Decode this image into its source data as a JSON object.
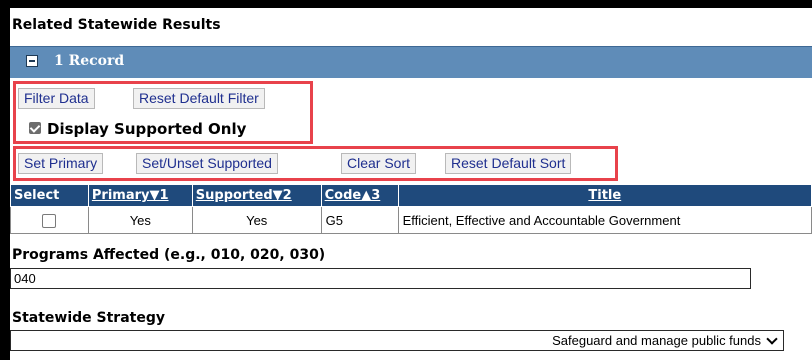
{
  "section": {
    "title": "Related Statewide Results",
    "record_label": "1 Record"
  },
  "filter": {
    "filter_data_label": "Filter Data",
    "reset_filter_label": "Reset Default Filter",
    "display_supported_label": "Display Supported Only",
    "display_supported_checked": true
  },
  "actions": {
    "set_primary_label": "Set Primary",
    "set_unset_supported_label": "Set/Unset Supported",
    "clear_sort_label": "Clear Sort",
    "reset_sort_label": "Reset Default Sort"
  },
  "table": {
    "headers": {
      "select": "Select",
      "primary": "Primary▼1",
      "supported": "Supported▼2",
      "code": "Code▲3",
      "title": "Title"
    },
    "rows": [
      {
        "selected": false,
        "primary": "Yes",
        "supported": "Yes",
        "code": "G5",
        "title": "Efficient, Effective and Accountable Government"
      }
    ]
  },
  "programs": {
    "label": "Programs Affected (e.g., 010, 020, 030)",
    "value": "040"
  },
  "strategy": {
    "label": "Statewide Strategy",
    "selected": "Safeguard and manage public funds"
  },
  "colors": {
    "record_bar": "#5f8cb8",
    "table_header": "#1f4a7c",
    "highlight_box": "#e8424b",
    "button_text": "#1f2f8f"
  }
}
